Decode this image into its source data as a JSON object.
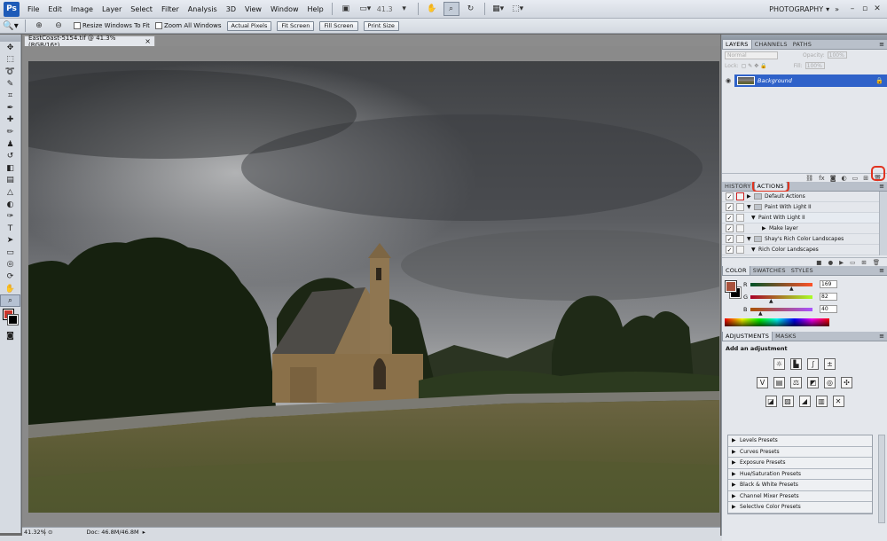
{
  "menu": {
    "logo": "Ps",
    "items": [
      "File",
      "Edit",
      "Image",
      "Layer",
      "Select",
      "Filter",
      "Analysis",
      "3D",
      "View",
      "Window",
      "Help"
    ],
    "zoom": "41.3",
    "workspace": "PHOTOGRAPHY"
  },
  "options": {
    "resize_windows": "Resize Windows To Fit",
    "zoom_all": "Zoom All Windows",
    "buttons": [
      "Actual Pixels",
      "Fit Screen",
      "Fill Screen",
      "Print Size"
    ]
  },
  "document": {
    "tab_title": "EastCoast-5154.tif @ 41.3% (RGB/16*)"
  },
  "status": {
    "zoom": "41.32%",
    "doc": "Doc: 46.8M/46.8M"
  },
  "layers_panel": {
    "tabs": [
      "LAYERS",
      "CHANNELS",
      "PATHS"
    ],
    "blend_mode": "Normal",
    "opacity_label": "Opacity:",
    "opacity": "100%",
    "lock_label": "Lock:",
    "fill_label": "Fill:",
    "fill": "100%",
    "layer_name": "Background"
  },
  "actions_panel": {
    "tabs": [
      "HISTORY",
      "ACTIONS"
    ],
    "rows": [
      {
        "label": "Default Actions",
        "indent": 0
      },
      {
        "label": "Paint With Light II",
        "indent": 0
      },
      {
        "label": "Paint With Light II",
        "indent": 1
      },
      {
        "label": "Make layer",
        "indent": 2
      },
      {
        "label": "Shay's Rich Color Landscapes",
        "indent": 0
      },
      {
        "label": "Rich Color Landscapes",
        "indent": 1
      }
    ]
  },
  "color_panel": {
    "tabs": [
      "COLOR",
      "SWATCHES",
      "STYLES"
    ],
    "r_label": "R",
    "r": "169",
    "g_label": "G",
    "g": "82",
    "b_label": "B",
    "b": "40",
    "colors": {
      "fg": "#a9523c",
      "bg": "#000000"
    }
  },
  "adjustments_panel": {
    "tabs": [
      "ADJUSTMENTS",
      "MASKS"
    ],
    "title": "Add an adjustment",
    "presets": [
      "Levels Presets",
      "Curves Presets",
      "Exposure Presets",
      "Hue/Saturation Presets",
      "Black & White Presets",
      "Channel Mixer Presets",
      "Selective Color Presets"
    ]
  }
}
